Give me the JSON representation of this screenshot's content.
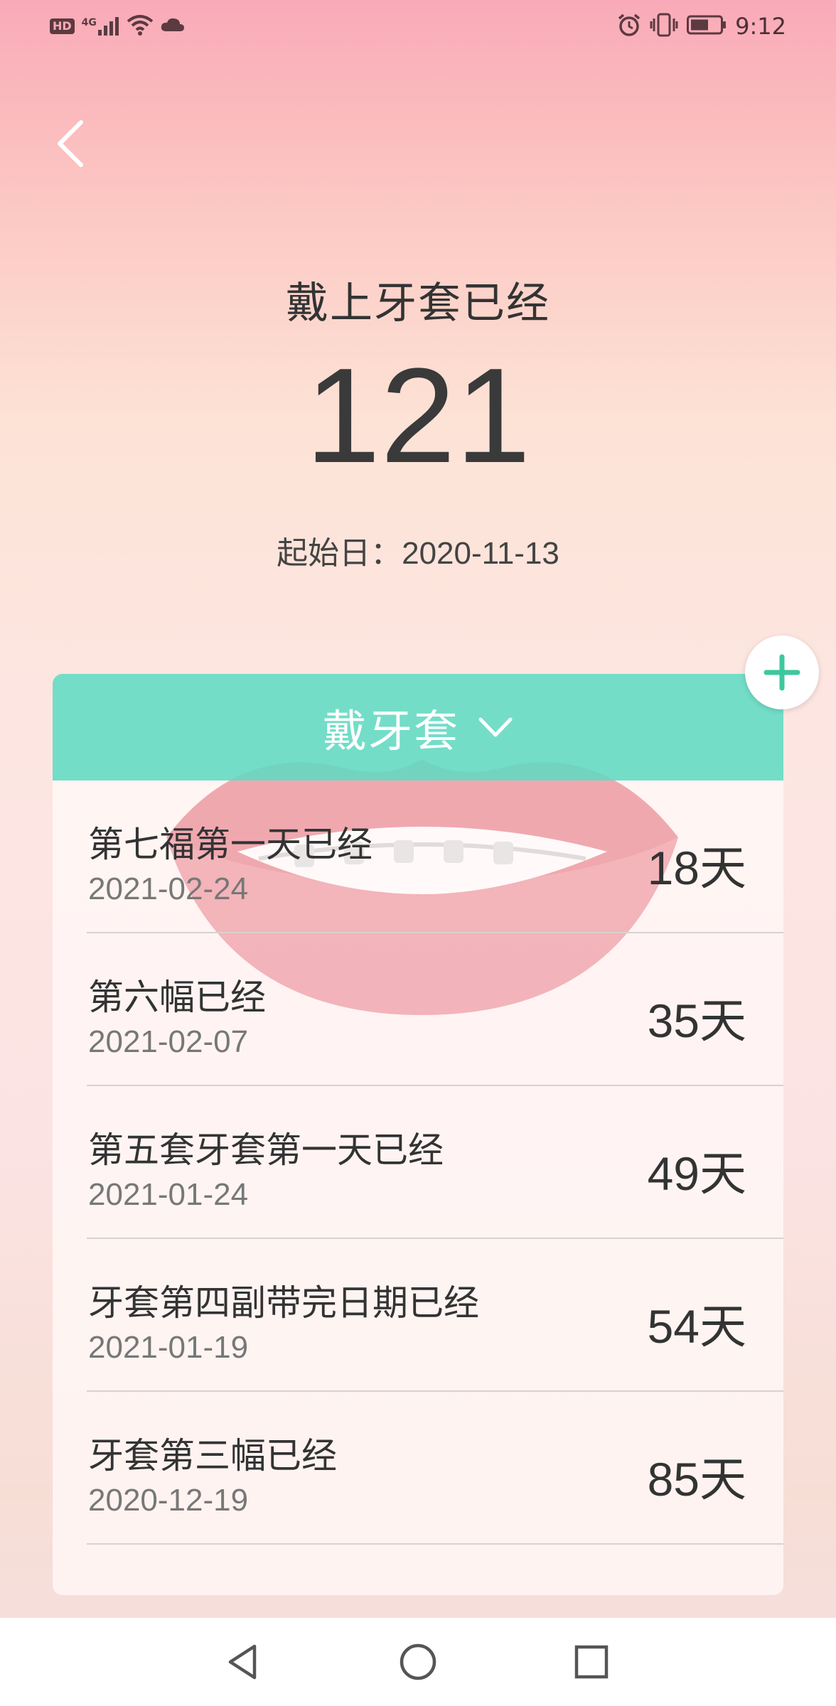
{
  "status_bar": {
    "network_label": "HD",
    "signal_label": "4G",
    "time": "9:12",
    "icons": [
      "hd-icon",
      "signal-4g-icon",
      "wifi-icon",
      "cloud-icon",
      "alarm-icon",
      "vibrate-icon",
      "battery-icon"
    ]
  },
  "hero": {
    "title": "戴上牙套已经",
    "count": "121",
    "start_label": "起始日：",
    "start_date": "2020-11-13"
  },
  "card": {
    "header_label": "戴牙套",
    "items": [
      {
        "title": "第七福第一天已经",
        "date": "2021-02-24",
        "days": "18天"
      },
      {
        "title": "第六幅已经",
        "date": "2021-02-07",
        "days": "35天"
      },
      {
        "title": "第五套牙套第一天已经",
        "date": "2021-01-24",
        "days": "49天"
      },
      {
        "title": "牙套第四副带完日期已经",
        "date": "2021-01-19",
        "days": "54天"
      },
      {
        "title": "牙套第三幅已经",
        "date": "2020-12-19",
        "days": "85天"
      }
    ]
  },
  "colors": {
    "accent": "#60d9c1",
    "add_icon": "#3ec79e",
    "text": "#333333"
  }
}
